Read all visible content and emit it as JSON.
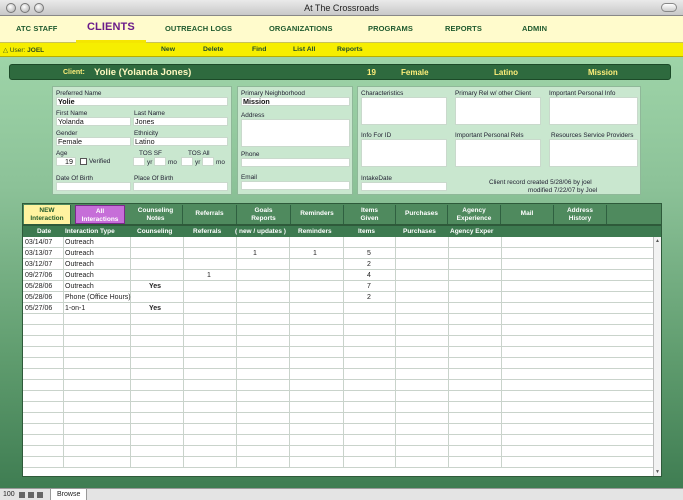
{
  "window": {
    "title": "At The Crossroads"
  },
  "main_nav": [
    {
      "label": "ATC STAFF"
    },
    {
      "label": "CLIENTS"
    },
    {
      "label": "OUTREACH LOGS"
    },
    {
      "label": "ORGANIZATIONS"
    },
    {
      "label": "PROGRAMS"
    },
    {
      "label": "REPORTS"
    },
    {
      "label": "ADMIN"
    }
  ],
  "sub_nav": {
    "user_label": "User:",
    "user_name": "JOEL",
    "items": [
      {
        "label": "New"
      },
      {
        "label": "Delete"
      },
      {
        "label": "Find"
      },
      {
        "label": "List All"
      },
      {
        "label": "Reports"
      }
    ]
  },
  "client_bar": {
    "label": "Client:",
    "name": "Yolie  (Yolanda Jones)",
    "age": "19",
    "gender": "Female",
    "ethnicity": "Latino",
    "neighborhood": "Mission"
  },
  "personal": {
    "preferred_name_label": "Preferred Name",
    "preferred_name": "Yolie",
    "first_name_label": "First Name",
    "first_name": "Yolanda",
    "last_name_label": "Last Name",
    "last_name": "Jones",
    "gender_label": "Gender",
    "gender": "Female",
    "ethnicity_label": "Ethnicity",
    "ethnicity": "Latino",
    "age_label": "Age",
    "age": "19",
    "verified_label": "Verified",
    "tos_sf_label": "TOS SF",
    "tos_all_label": "TOS All",
    "yr_label": "yr",
    "mo_label": "mo",
    "dob_label": "Date Of Birth",
    "pob_label": "Place Of Birth"
  },
  "location": {
    "neighborhood_label": "Primary Neighborhood",
    "neighborhood": "Mission",
    "address_label": "Address",
    "phone_label": "Phone",
    "email_label": "Email"
  },
  "info": {
    "characteristics_label": "Characteristics",
    "primary_rel_label": "Primary Rel w/ other Client",
    "important_personal_info_label": "Important Personal Info",
    "info_for_id_label": "Info For ID",
    "important_personal_rels_label": "Important Personal Rels",
    "resources_label": "Resources Service Providers",
    "intake_date_label": "IntakeDate",
    "created_text": "Client record created  5/28/06  by  joel",
    "modified_text": "modified  7/22/07  by  Joel"
  },
  "tabs": [
    {
      "line1": "NEW",
      "line2": "Interaction"
    },
    {
      "line1": "All",
      "line2": "Interactions"
    },
    {
      "line1": "Counseling",
      "line2": "Notes"
    },
    {
      "line1": "Referrals",
      "line2": ""
    },
    {
      "line1": "Goals",
      "line2": "Reports"
    },
    {
      "line1": "Reminders",
      "line2": ""
    },
    {
      "line1": "Items",
      "line2": "Given"
    },
    {
      "line1": "Purchases",
      "line2": ""
    },
    {
      "line1": "Agency",
      "line2": "Experience"
    },
    {
      "line1": "Mail",
      "line2": ""
    },
    {
      "line1": "Address",
      "line2": "History"
    }
  ],
  "table": {
    "columns": [
      "Date",
      "Interaction Type",
      "Counseling",
      "Referrals",
      "( new / updates )",
      "Reminders",
      "Items",
      "Purchases",
      "Agency Exper"
    ],
    "rows": [
      {
        "date": "03/14/07",
        "type": "Outreach",
        "counseling": "",
        "referrals": "",
        "goals": "",
        "reminders": "",
        "items": ""
      },
      {
        "date": "03/13/07",
        "type": "Outreach",
        "counseling": "",
        "referrals": "",
        "goals": "1",
        "reminders": "1",
        "items": "5"
      },
      {
        "date": "03/12/07",
        "type": "Outreach",
        "counseling": "",
        "referrals": "",
        "goals": "",
        "reminders": "",
        "items": "2"
      },
      {
        "date": "09/27/06",
        "type": "Outreach",
        "counseling": "",
        "referrals": "1",
        "goals": "",
        "reminders": "",
        "items": "4"
      },
      {
        "date": "05/28/06",
        "type": "Outreach",
        "counseling": "Yes",
        "referrals": "",
        "goals": "",
        "reminders": "",
        "items": "7"
      },
      {
        "date": "05/28/06",
        "type": "Phone (Office Hours)",
        "counseling": "",
        "referrals": "",
        "goals": "",
        "reminders": "",
        "items": "2"
      },
      {
        "date": "05/27/06",
        "type": "1-on-1",
        "counseling": "Yes",
        "referrals": "",
        "goals": "",
        "reminders": "",
        "items": ""
      }
    ]
  },
  "status_bar": {
    "zoom": "100",
    "mode": "Browse"
  }
}
